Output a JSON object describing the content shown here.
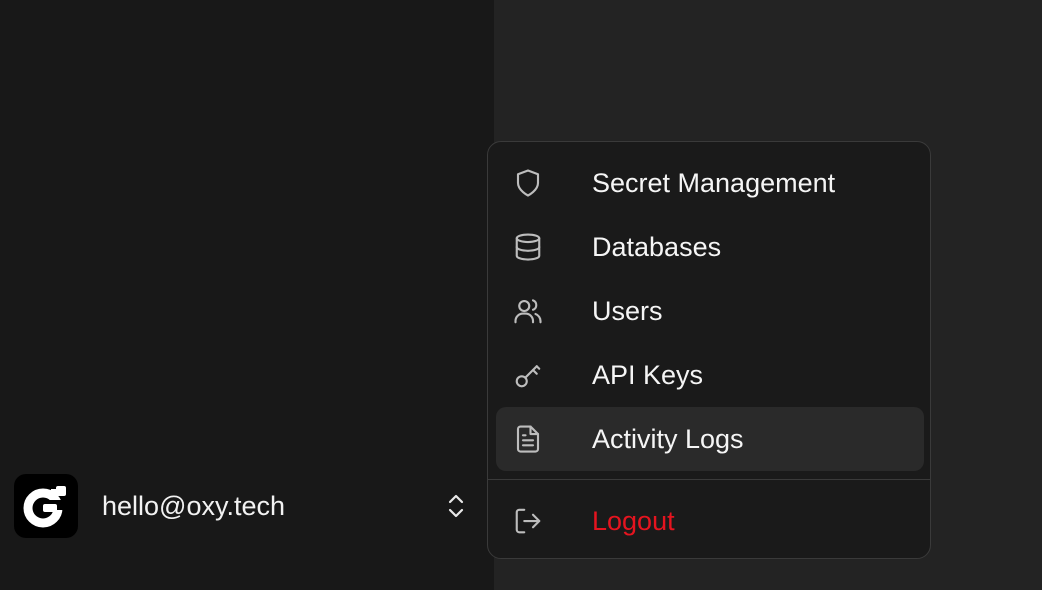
{
  "user": {
    "email": "hello@oxy.tech",
    "avatar_icon": "logo-icon"
  },
  "menu": {
    "items": [
      {
        "label": "Secret Management",
        "icon": "shield-icon"
      },
      {
        "label": "Databases",
        "icon": "database-icon"
      },
      {
        "label": "Users",
        "icon": "users-icon"
      },
      {
        "label": "API Keys",
        "icon": "key-icon"
      },
      {
        "label": "Activity Logs",
        "icon": "file-text-icon",
        "active": true
      }
    ],
    "logout": {
      "label": "Logout",
      "icon": "logout-icon",
      "color": "#e5141f"
    }
  },
  "colors": {
    "sidebar_bg": "#181818",
    "main_bg": "#232323",
    "menu_bg": "#1a1a1a",
    "active_bg": "#2a2a2a",
    "danger": "#e5141f"
  }
}
